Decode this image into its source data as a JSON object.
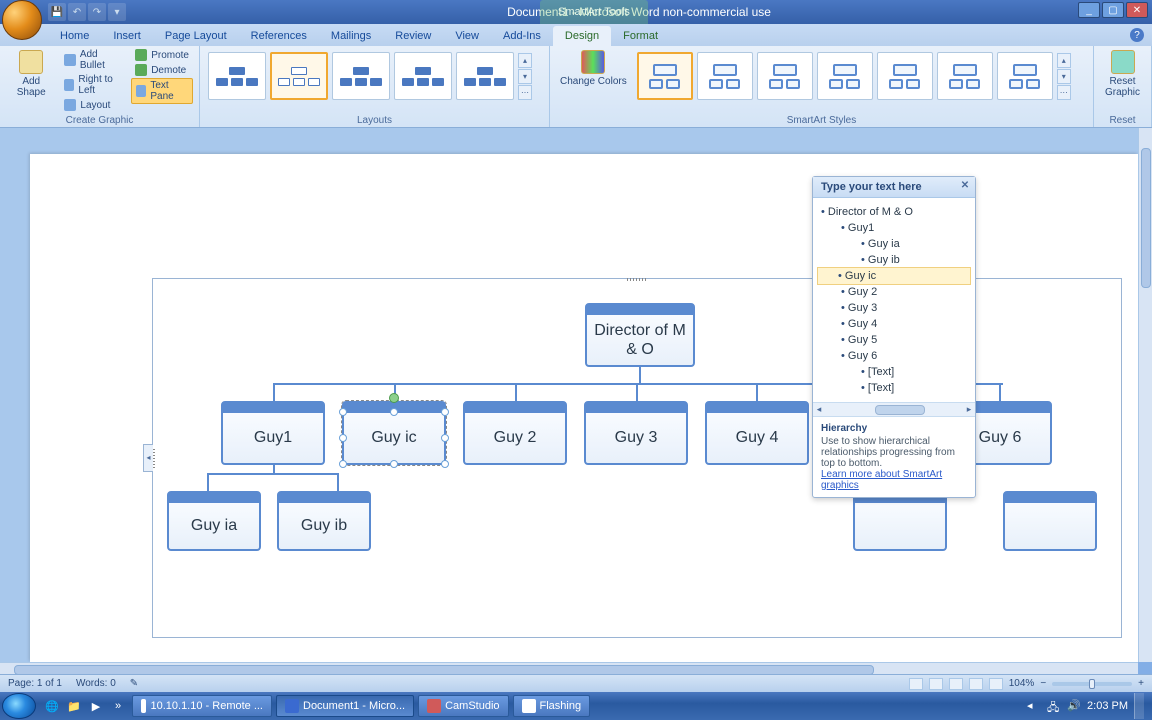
{
  "window": {
    "title": "Document1 - Microsoft Word non-commercial use",
    "contextual_tab_group": "SmartArt Tools"
  },
  "ribbon": {
    "tabs": [
      "Home",
      "Insert",
      "Page Layout",
      "References",
      "Mailings",
      "Review",
      "View",
      "Add-Ins",
      "Design",
      "Format"
    ],
    "active_tab": "Design",
    "groups": {
      "create_graphic": {
        "label": "Create Graphic",
        "add_shape": "Add Shape",
        "add_bullet": "Add Bullet",
        "right_to_left": "Right to Left",
        "layout": "Layout",
        "promote": "Promote",
        "demote": "Demote",
        "text_pane": "Text Pane"
      },
      "layouts": {
        "label": "Layouts"
      },
      "change_colors": "Change Colors",
      "smartart_styles": {
        "label": "SmartArt Styles"
      },
      "reset": {
        "label": "Reset",
        "reset_graphic": "Reset Graphic"
      }
    }
  },
  "textpane": {
    "header": "Type your text here",
    "items": [
      {
        "level": 1,
        "text": "Director of M & O"
      },
      {
        "level": 2,
        "text": "Guy1"
      },
      {
        "level": 3,
        "text": "Guy ia"
      },
      {
        "level": 3,
        "text": "Guy ib"
      },
      {
        "level": 2,
        "text": "Guy ic",
        "selected": true
      },
      {
        "level": 2,
        "text": "Guy 2"
      },
      {
        "level": 2,
        "text": "Guy 3"
      },
      {
        "level": 2,
        "text": "Guy 4"
      },
      {
        "level": 2,
        "text": "Guy 5"
      },
      {
        "level": 2,
        "text": "Guy 6"
      },
      {
        "level": 3,
        "text": "[Text]"
      },
      {
        "level": 3,
        "text": "[Text]"
      }
    ],
    "info": {
      "title": "Hierarchy",
      "desc": "Use to show hierarchical relationships progressing from top to bottom.",
      "link": "Learn more about SmartArt graphics"
    }
  },
  "chart": {
    "root": "Director of M & O",
    "row2": [
      "Guy1",
      "Guy ic",
      "Guy 2",
      "Guy 3",
      "Guy 4",
      "",
      "Guy 6"
    ],
    "row2_selected_index": 1,
    "row3_under_guy1": [
      "Guy ia",
      "Guy ib"
    ]
  },
  "statusbar": {
    "page": "Page: 1 of 1",
    "words": "Words: 0",
    "zoom": "104%"
  },
  "taskbar": {
    "items": [
      {
        "label": "10.10.1.10 - Remote ..."
      },
      {
        "label": "Document1 - Micro...",
        "active": true
      },
      {
        "label": "CamStudio"
      },
      {
        "label": "Flashing"
      }
    ],
    "clock": "2:03 PM"
  }
}
